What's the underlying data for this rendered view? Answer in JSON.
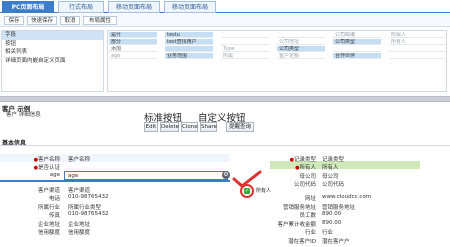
{
  "tabs": [
    {
      "label": "PC页面布局",
      "active": true
    },
    {
      "label": "行式布局",
      "active": false
    },
    {
      "label": "移动页面布局",
      "active": false
    },
    {
      "label": "移动页面布局",
      "active": false
    }
  ],
  "toolbar": {
    "save": "保存",
    "quick_save": "快速保存",
    "cancel": "取消",
    "layout_props": "布局属性"
  },
  "left_list": [
    "字段",
    "按钮",
    "相关列表",
    "详细页面内嵌自定义页面"
  ],
  "field_grid": {
    "col1": [
      "是什",
      "部分",
      "添加",
      "age"
    ],
    "col2": [
      "testu",
      "test查找用户",
      "",
      "业务范围"
    ],
    "col3": [
      "",
      "",
      "Type",
      "所属"
    ],
    "col4": [
      "",
      "公司地址",
      "公司类型",
      "客户定额"
    ],
    "col5": [
      "公司邮编",
      "公司类型",
      "",
      "合作伙伴"
    ],
    "col6": [
      "所属人",
      "所有人",
      "",
      ""
    ]
  },
  "preview": {
    "title": "客户 示例",
    "sub": "客户 详细信息",
    "std_title": "标准按钮",
    "custom_title": "自定义按钮",
    "buttons": [
      "Edit",
      "Delete",
      "Clone",
      "Share"
    ],
    "custom_button": "提醒查询"
  },
  "section": {
    "title": "基本信息"
  },
  "fields": {
    "customer_name_label": "客户名称",
    "customer_name_value": "客户名称",
    "customer_verify_label": "是否认证",
    "age_label": "age",
    "age_value": "age",
    "customer_source_label": "客户渠道",
    "customer_source_value": "客户渠道",
    "phone_label": "电话",
    "phone_value": "010-98765432",
    "industry_label": "所属行业",
    "industry_value": "所属行业类型",
    "fax_label": "传真",
    "fax_value": "010-98765432",
    "address_label": "企业地址",
    "address_value": "企业地址",
    "credit_label": "信用额度",
    "credit_value": "信用额度",
    "record_type_label": "记录类型",
    "record_type_value": "记录类型",
    "owner_label": "所有人",
    "owner_value": "所有人",
    "parent_label": "母公司",
    "parent_value": "母公司",
    "code_label": "公司代码",
    "code_value": "公司代码",
    "website_label": "网址",
    "website_value": "www.cloudcc.com",
    "reg_addr_label": "营销服务地址",
    "reg_addr_value": "营销服务地址",
    "employees_label": "员工数",
    "employees_value": "890.00",
    "annual_label": "客户累计收金额",
    "annual_value": "890.00",
    "industry2_label": "行业",
    "industry2_value": "行业",
    "potential_label": "潜在客户ID",
    "potential_value": "潜在客户户"
  },
  "badge": {
    "icon_letter": "✓",
    "label": "所有人"
  },
  "colors": {
    "accent": "#3a7ecb",
    "highlight": "#c6def4",
    "green_band": "#cfe8b8",
    "red_mark": "#d33"
  }
}
